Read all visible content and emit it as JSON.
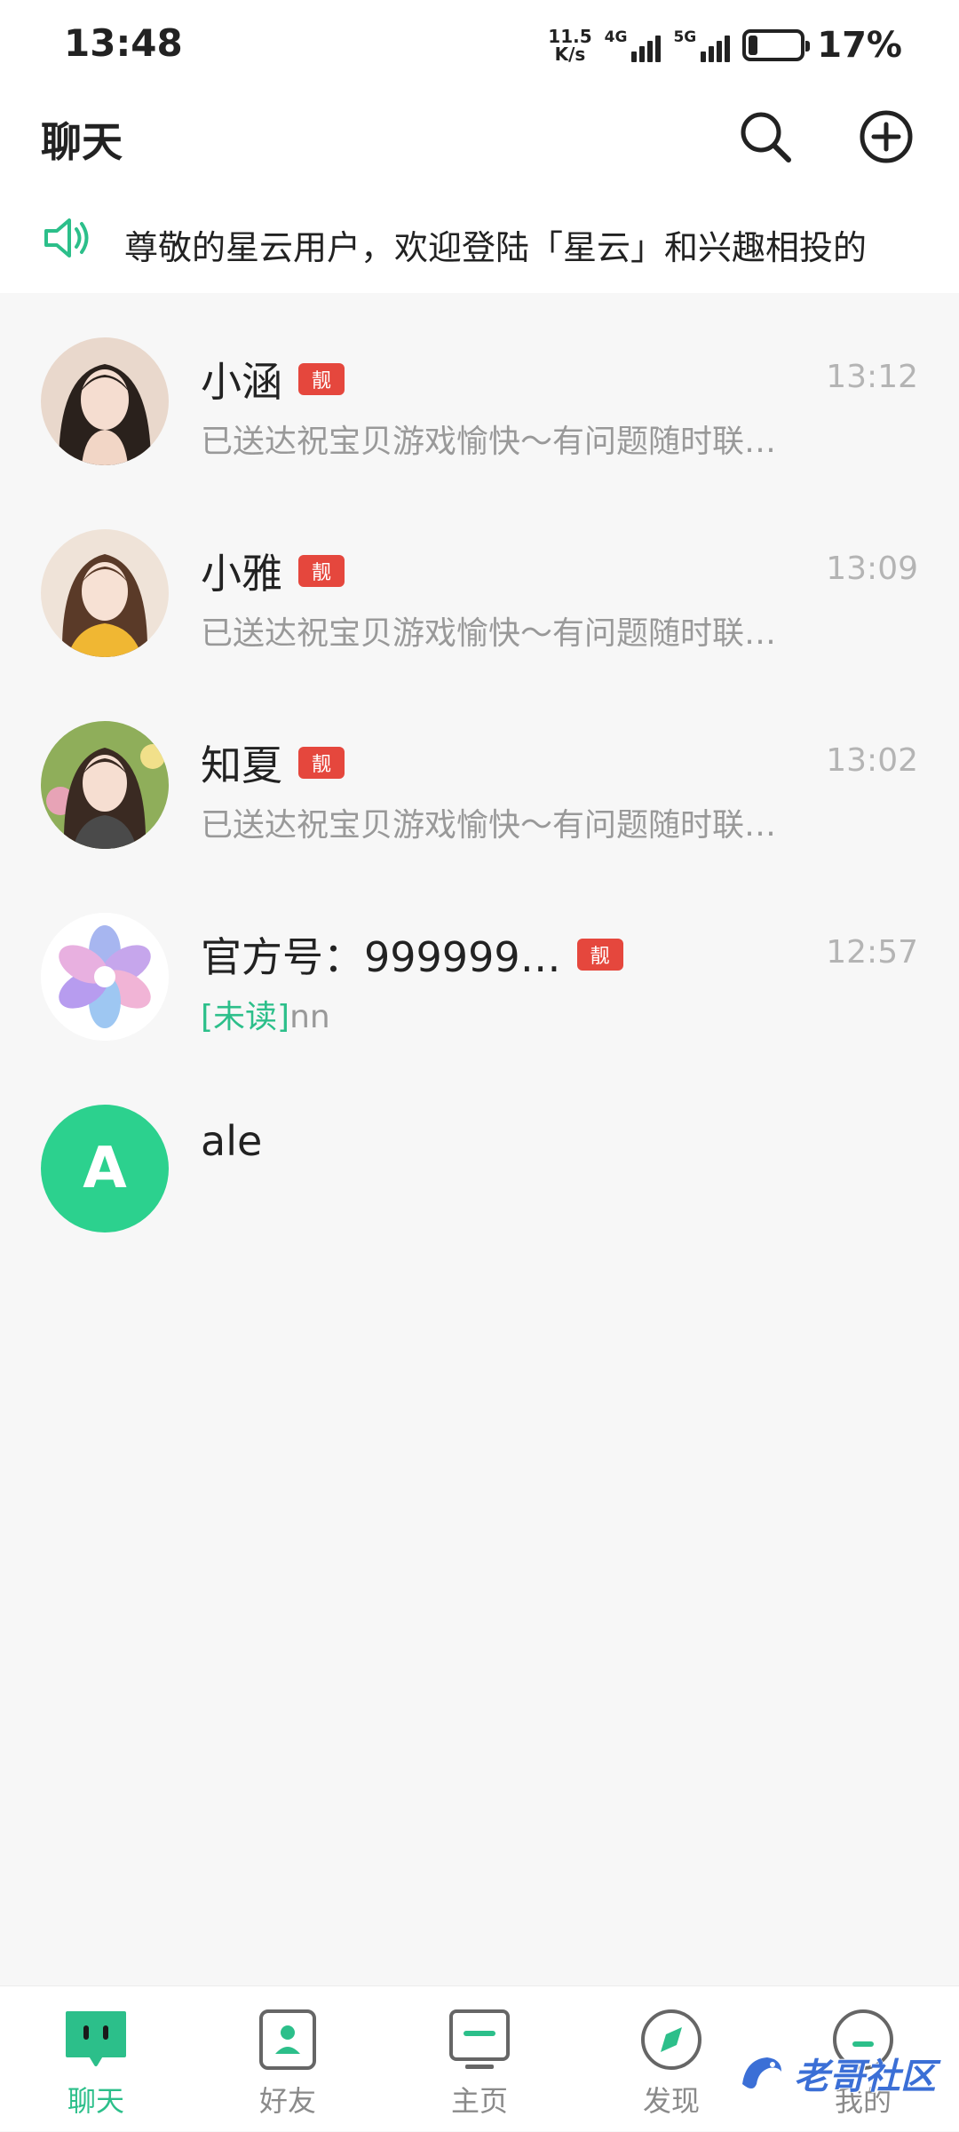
{
  "status_bar": {
    "time": "13:48",
    "net_speed_value": "11.5",
    "net_speed_unit": "K/s",
    "signal_1_tag": "4G",
    "signal_2_tag": "5G",
    "battery_percent": "17%",
    "battery_level": 0.17
  },
  "header": {
    "title": "聊天",
    "search_icon": "search-icon",
    "add_icon": "plus-circle-icon"
  },
  "notice": {
    "icon": "speaker-icon",
    "text": "尊敬的星云用户，欢迎登陆「星云」和兴趣相投的"
  },
  "chats": [
    {
      "name": "小涵",
      "badge": "靓",
      "time": "13:12",
      "preview": "已送达祝宝贝游戏愉快～有问题随时联…"
    },
    {
      "name": "小雅",
      "badge": "靓",
      "time": "13:09",
      "preview": "已送达祝宝贝游戏愉快～有问题随时联…"
    },
    {
      "name": "知夏",
      "badge": "靓",
      "time": "13:02",
      "preview": "已送达祝宝贝游戏愉快～有问题随时联…"
    },
    {
      "name": "官方号：999999…",
      "badge": "靓",
      "time": "12:57",
      "unread_tag": "[未读]",
      "preview": "nn"
    },
    {
      "name": "ale",
      "avatar_letter": "A"
    }
  ],
  "tabs": [
    {
      "label": "聊天",
      "icon": "chat-icon",
      "active": true
    },
    {
      "label": "好友",
      "icon": "contacts-icon",
      "active": false
    },
    {
      "label": "主页",
      "icon": "home-icon",
      "active": false
    },
    {
      "label": "发现",
      "icon": "compass-icon",
      "active": false
    },
    {
      "label": "我的",
      "icon": "profile-icon",
      "active": false
    }
  ],
  "watermark": {
    "text": "老哥社区"
  },
  "colors": {
    "accent": "#2cbf8a",
    "badge": "#e5473d",
    "background": "#f7f7f7"
  }
}
